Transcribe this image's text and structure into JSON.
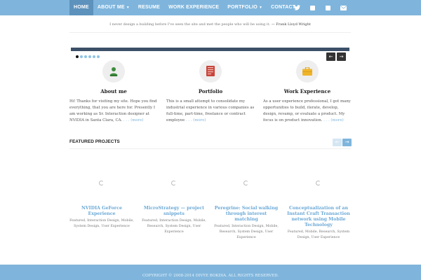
{
  "nav": {
    "items": [
      {
        "label": "HOME",
        "active": true
      },
      {
        "label": "ABOUT ME",
        "dropdown": true
      },
      {
        "label": "RESUME"
      },
      {
        "label": "WORK EXPERIENCE"
      },
      {
        "label": "PORTFOLIO",
        "dropdown": true
      },
      {
        "label": "CONTACT"
      }
    ],
    "social": [
      "twitter-icon",
      "blogger-icon",
      "linkedin-icon",
      "mail-icon"
    ]
  },
  "quote": {
    "text": "I never design a building before I've seen the site and met the people who will be using it.",
    "author": "— Frank Lloyd Wright"
  },
  "slider": {
    "dots": 6,
    "active_dot": 0,
    "prev": "←",
    "next": "→"
  },
  "features": [
    {
      "icon": "user-icon",
      "title": "About me",
      "text": "Hi! Thanks for visiting my site. Hope you find everything, that you are here for. Presently I am working as Sr. Interaction designer at NVIDIA  in Santa Clara, CA.",
      "more": ". . . (more)"
    },
    {
      "icon": "portfolio-book-icon",
      "title": "Portfolio",
      "text": "This is a small attempt to consolidate my industrial experience in various companies as full-time, part-time, freelance or contract employee",
      "more": ". . . (more)"
    },
    {
      "icon": "briefcase-icon",
      "title": "Work Experience",
      "text": "As a user experience professional, I got many opportunities to build, iterate, develop, design, revamp, or evaluate a product. My focus is on product innovation.",
      "more": ". . . (more)"
    }
  ],
  "featured": {
    "title": "FEATURED PROJECTS",
    "prev": "←",
    "next": "→",
    "projects": [
      {
        "title": "NVIDIA GeForce Experience",
        "tags": "Featured, Interaction Design, Mobile, System Design, User Experience"
      },
      {
        "title": "MicroStrategy — project snippets",
        "tags": "Featured, Interaction Design, Mobile, Research, System Design, User Experience"
      },
      {
        "title": "Peregrine: Social walking through interest matching",
        "tags": "Featured, Interaction Design, Mobile, Research, System Design, User Experience"
      },
      {
        "title": "Conceptualization of an Instant Craft Transaction network using Mobile Technology",
        "tags": "Featured, Mobile, Research, System Design, User Experience"
      }
    ]
  },
  "footer": {
    "text": "COPYRIGHT © 2008-2014 DIVYE BOKDIA. ALL RIGHTS RESERVED."
  },
  "colors": {
    "brand": "#7fb5dc",
    "nav_active": "#5d92bd",
    "link": "#6aa8d6",
    "slider_bar": "#3b5068"
  }
}
